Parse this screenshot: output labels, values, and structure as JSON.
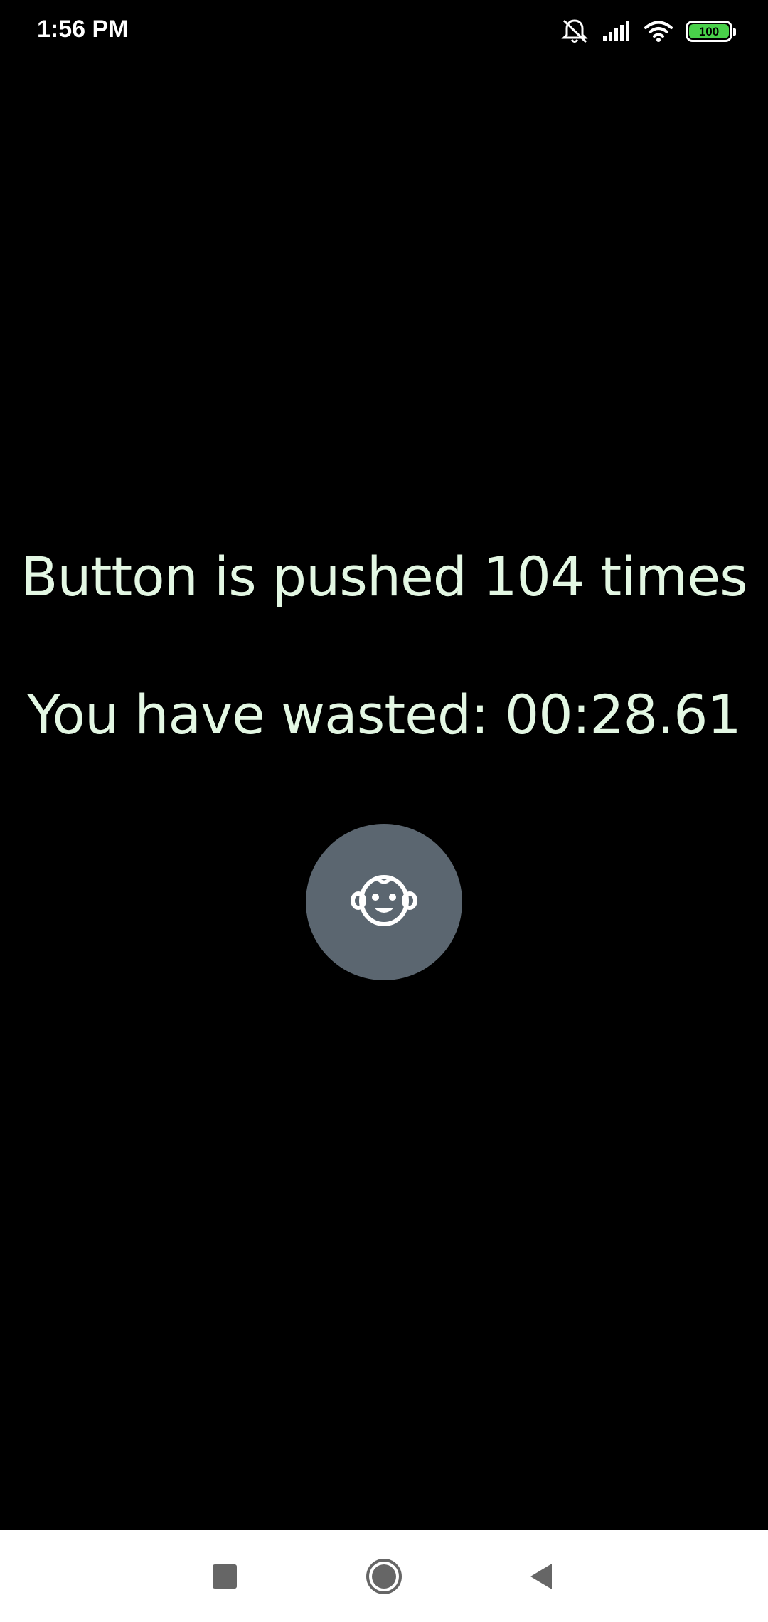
{
  "status_bar": {
    "time": "1:56 PM",
    "battery_level": "100",
    "icons": [
      "mute-icon",
      "signal-icon",
      "wifi-icon",
      "battery-icon"
    ],
    "battery_color": "#49d14a"
  },
  "main": {
    "push_count_text": "Button is pushed 104 times",
    "wasted_time_text": "You have wasted: 00:28.61",
    "text_color": "#e3f7e3",
    "button": {
      "icon": "baby-face-icon",
      "background": "#5b6670"
    }
  },
  "nav_bar": {
    "items": [
      "recent-apps",
      "home",
      "back"
    ]
  }
}
